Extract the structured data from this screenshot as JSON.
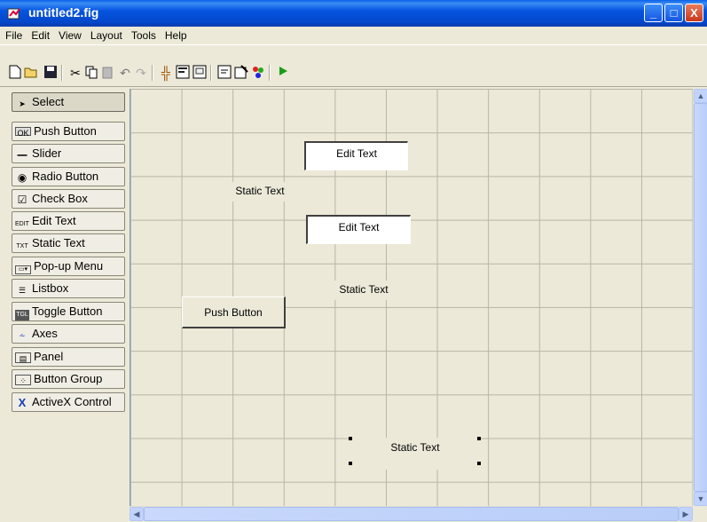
{
  "window": {
    "title": "untitled2.fig",
    "controls": {
      "minimize": "_",
      "maximize": "□",
      "close": "X"
    }
  },
  "menu": [
    "File",
    "Edit",
    "View",
    "Layout",
    "Tools",
    "Help"
  ],
  "toolbar_icons": [
    "new-icon",
    "open-icon",
    "save-icon",
    "cut-icon",
    "copy-icon",
    "paste-icon",
    "undo-icon",
    "redo-icon",
    "align-icon",
    "menu-editor-icon",
    "tab-order-icon",
    "m-file-editor-icon",
    "property-inspector-icon",
    "object-browser-icon",
    "run-icon"
  ],
  "palette": [
    {
      "label": "Select",
      "icon": "arrow-icon",
      "selected": true
    },
    {
      "label": "Push Button",
      "icon": "push-button-icon"
    },
    {
      "label": "Slider",
      "icon": "slider-icon"
    },
    {
      "label": "Radio Button",
      "icon": "radio-icon"
    },
    {
      "label": "Check Box",
      "icon": "checkbox-icon"
    },
    {
      "label": "Edit Text",
      "icon": "edit-text-icon"
    },
    {
      "label": "Static Text",
      "icon": "static-text-icon"
    },
    {
      "label": "Pop-up Menu",
      "icon": "popup-menu-icon"
    },
    {
      "label": "Listbox",
      "icon": "listbox-icon"
    },
    {
      "label": "Toggle Button",
      "icon": "toggle-icon"
    },
    {
      "label": "Axes",
      "icon": "axes-icon"
    },
    {
      "label": "Panel",
      "icon": "panel-icon"
    },
    {
      "label": "Button Group",
      "icon": "button-group-icon"
    },
    {
      "label": "ActiveX Control",
      "icon": "activex-icon"
    }
  ],
  "components": {
    "edit1": "Edit Text",
    "edit2": "Edit Text",
    "static1": "Static Text",
    "static2": "Static Text",
    "static3": "Static Text",
    "push1": "Push Button"
  },
  "colors": {
    "titlebar": "#0554e0",
    "background": "#ece9d8",
    "grid": "#b9b5a6"
  }
}
